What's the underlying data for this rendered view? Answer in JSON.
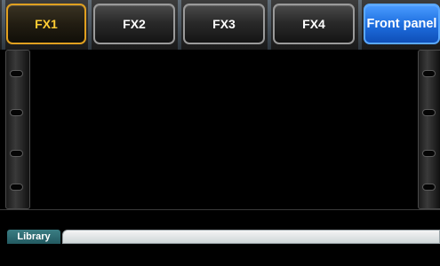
{
  "tabs": [
    {
      "label": "FX1",
      "active": true
    },
    {
      "label": "FX2",
      "active": false
    },
    {
      "label": "FX3",
      "active": false
    },
    {
      "label": "FX4",
      "active": false
    },
    {
      "label": "Front panel",
      "active": false
    }
  ],
  "library": {
    "tab_label": "Library",
    "field_value": ""
  },
  "colors": {
    "active_accent": "#e0a020",
    "front_panel": "#1f6fe0",
    "library_tab": "#2f6e75"
  }
}
